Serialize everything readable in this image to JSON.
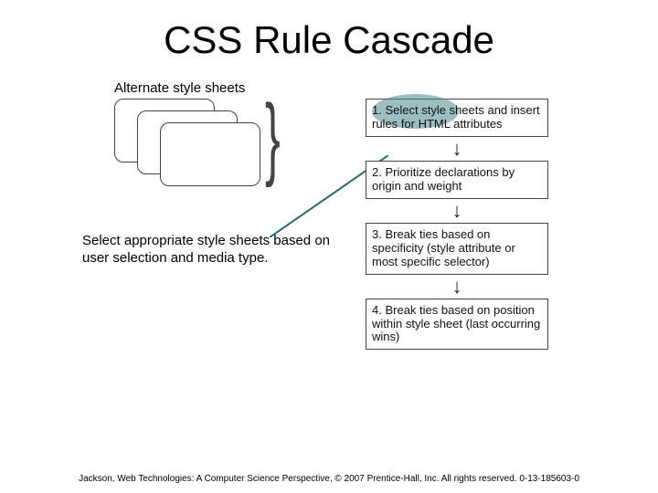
{
  "title": "CSS Rule Cascade",
  "alt_label": "Alternate style sheets",
  "callout": "Select appropriate style sheets based on user selection and media type.",
  "steps": [
    {
      "n": "1.",
      "t": "Select style sheets and insert rules for HTML attributes"
    },
    {
      "n": "2.",
      "t": "Prioritize declarations by origin and weight"
    },
    {
      "n": "3.",
      "t": "Break ties based on specificity (style attribute or most specific selector)"
    },
    {
      "n": "4.",
      "t": "Break ties based on position within style sheet (last occurring wins)"
    }
  ],
  "footer": "Jackson, Web Technologies: A Computer Science Perspective, © 2007 Prentice-Hall, Inc. All rights reserved. 0-13-185603-0"
}
